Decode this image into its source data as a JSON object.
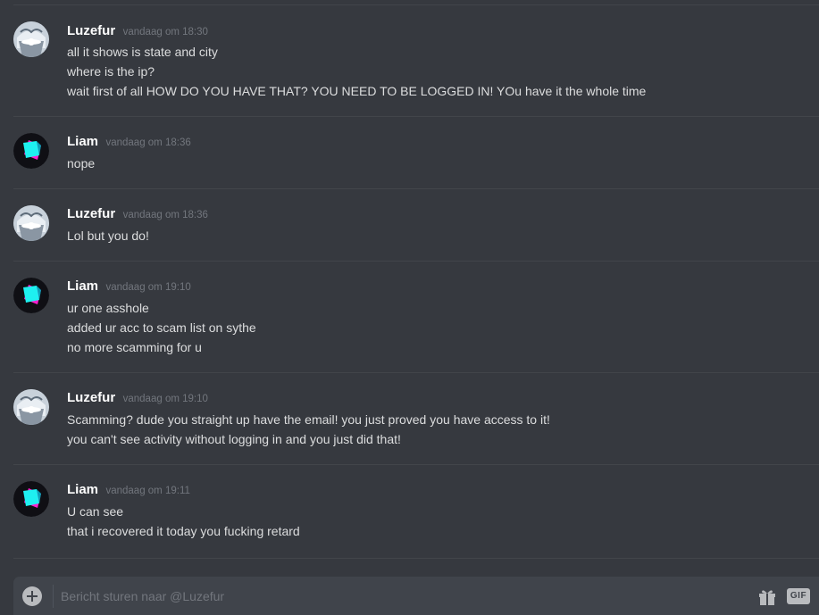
{
  "messages": [
    {
      "user": "Luzefur",
      "avatar": "anime-character-avatar",
      "time": "vandaag om 18:30",
      "lines": [
        "all it shows is state and city",
        "where is the ip?",
        "wait first of all HOW DO YOU HAVE THAT? YOU NEED TO BE LOGGED IN! YOu have it the whole time"
      ]
    },
    {
      "user": "Liam",
      "avatar": "cube-avatar",
      "time": "vandaag om 18:36",
      "lines": [
        "nope"
      ]
    },
    {
      "user": "Luzefur",
      "avatar": "anime-character-avatar",
      "time": "vandaag om 18:36",
      "lines": [
        "Lol but you do!"
      ]
    },
    {
      "user": "Liam",
      "avatar": "cube-avatar",
      "time": "vandaag om 19:10",
      "lines": [
        "ur one asshole",
        "added ur acc to scam list on sythe",
        "no more scamming for u"
      ]
    },
    {
      "user": "Luzefur",
      "avatar": "anime-character-avatar",
      "time": "vandaag om 19:10",
      "lines": [
        "Scamming? dude you straight up have the email! you just proved you have access to it!",
        "you can't see activity without logging in and you just did that!"
      ]
    },
    {
      "user": "Liam",
      "avatar": "cube-avatar",
      "time": "vandaag om 19:11",
      "lines": [
        "U can see",
        "that i recovered it today you fucking retard"
      ]
    }
  ],
  "composer": {
    "placeholder": "Bericht sturen naar @Luzefur",
    "value": "",
    "gif_label": "GIF",
    "icons": [
      "plus-circle-icon",
      "gift-icon",
      "gif-icon"
    ]
  },
  "colors": {
    "background": "#36393f",
    "input_background": "#40444b",
    "username": "#ffffff",
    "timestamp": "#72767d",
    "text": "#dcddde"
  }
}
